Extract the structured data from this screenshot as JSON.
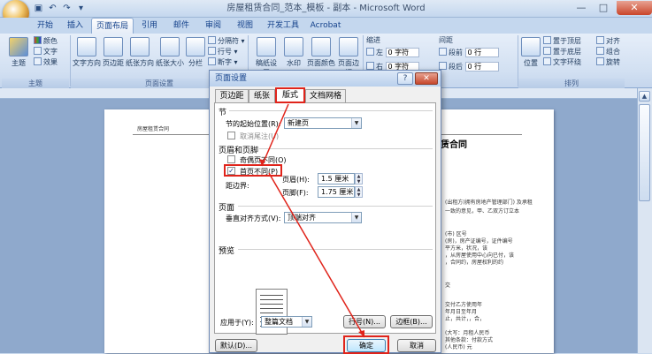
{
  "window": {
    "title": "房屋租赁合同_范本_模板 - 副本 - Microsoft Word",
    "minimize": "—",
    "maximize": "□",
    "close": "✕"
  },
  "quick_access": {
    "save": "▣",
    "undo": "↶",
    "redo": "↷",
    "more": "▾"
  },
  "ribbon_tabs": [
    "开始",
    "插入",
    "页面布局",
    "引用",
    "邮件",
    "审阅",
    "视图",
    "开发工具",
    "Acrobat"
  ],
  "ribbon": {
    "theme_group": {
      "label": "主题",
      "theme": "主题",
      "colors": "颜色",
      "fonts": "文字",
      "effects": "效果"
    },
    "page_setup_group": {
      "label": "页面设置",
      "text_direction": "文字方向",
      "margins": "页边距",
      "orientation": "纸张方向",
      "size": "纸张大小",
      "columns": "分栏",
      "breaks": "分隔符",
      "line_numbers": "行号",
      "hyphenation": "断字"
    },
    "draft": "稿纸设置",
    "watermark": "水印",
    "page_color": "页面颜色",
    "page_borders": "页面边框",
    "indent": {
      "label": "缩进",
      "left_icon": "左",
      "left_value": "0 字符",
      "right_icon": "右",
      "right_value": "0 字符"
    },
    "spacing": {
      "label": "间距",
      "before_icon": "段前",
      "before_value": "0 行",
      "after_icon": "段后",
      "after_value": "0 行"
    },
    "position": "位置",
    "arrange_group": {
      "label": "排列",
      "bring_front": "置于顶层",
      "send_back": "置于底层",
      "text_wrap": "文字环绕",
      "align": "对齐",
      "group": "组合",
      "rotate": "旋转"
    }
  },
  "document": {
    "header_text": "房屋租赁合同",
    "title_fragment": "赁合同",
    "lines": [
      "(出租方)拥有房地产管理部门) 及承租",
      "一致的意见，甲、乙双方订立本",
      "(市) 区号",
      "(房)，房产证编号，证件编号",
      "平方米，状况，该",
      "，从房屋使用中心向已付，该",
      "，合同约，房屋权利的约",
      "交",
      "交付乙方使用年",
      "年月日至年月",
      "止，共计，，合，",
      "(大写：月租人民币",
      "其他条款：付款方式",
      "(人民币) 元"
    ]
  },
  "dialog": {
    "title": "页面设置",
    "help": "?",
    "close": "✕",
    "tabs": [
      "页边距",
      "纸张",
      "版式",
      "文档网格"
    ],
    "section_label": "节",
    "section_start_label": "节的起始位置(R):",
    "section_start_value": "新建页",
    "suppress_endnotes": "取消尾注(U)",
    "header_footer_label": "页眉和页脚",
    "odd_even": "奇偶页不同(O)",
    "different_first": "首页不同(P)",
    "different_first_check": "✓",
    "from_edge_label": "距边界:",
    "header_label": "页眉(H):",
    "header_value": "1.5 厘米",
    "footer_label": "页脚(F):",
    "footer_value": "1.75 厘米",
    "page_label": "页面",
    "valign_label": "垂直对齐方式(V):",
    "valign_value": "顶端对齐",
    "preview_label": "预览",
    "apply_label": "应用于(Y):",
    "apply_value": "整篇文档",
    "line_numbers": "行号(N)...",
    "borders": "边框(B)...",
    "default": "默认(D)...",
    "ok": "确定",
    "cancel": "取消"
  }
}
